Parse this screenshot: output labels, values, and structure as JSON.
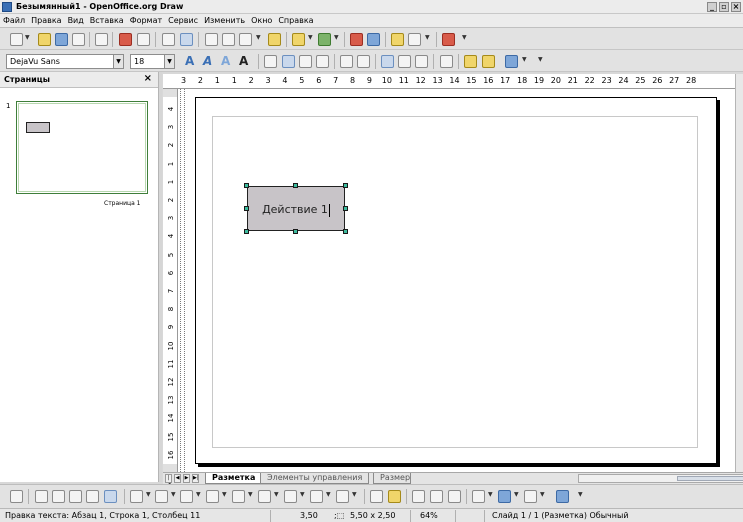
{
  "window": {
    "title": "Безымянный1 - OpenOffice.org Draw"
  },
  "menu": [
    "Файл",
    "Правка",
    "Вид",
    "Вставка",
    "Формат",
    "Сервис",
    "Изменить",
    "Окно",
    "Справка"
  ],
  "format_toolbar": {
    "font_name": "DejaVu Sans",
    "font_size": "18"
  },
  "pages_panel": {
    "title": "Страницы",
    "close_glyph": "×",
    "page_number": "1",
    "page_caption": "Страница 1"
  },
  "hruler_labels": [
    "3",
    "2",
    "1",
    "1",
    "2",
    "3",
    "4",
    "5",
    "6",
    "7",
    "8",
    "9",
    "10",
    "11",
    "12",
    "13",
    "14",
    "15",
    "16",
    "17",
    "18",
    "19",
    "20",
    "21",
    "22",
    "23",
    "24",
    "25",
    "26",
    "27",
    "28"
  ],
  "vruler_labels": [
    "4",
    "3",
    "2",
    "1",
    "1",
    "2",
    "3",
    "4",
    "5",
    "6",
    "7",
    "8",
    "9",
    "10",
    "11",
    "12",
    "13",
    "14",
    "15",
    "16"
  ],
  "shape": {
    "text": "Действие 1"
  },
  "tabs": [
    "Разметка",
    "Элементы управления",
    "Размер"
  ],
  "status": {
    "edit_info": "Правка текста: Абзац 1, Строка 1, Столбец 11",
    "position": "3,50",
    "size": "5,50 x 2,50",
    "zoom": "64%",
    "slide_info": "Слайд 1 / 1 (Разметка) Обычный"
  }
}
